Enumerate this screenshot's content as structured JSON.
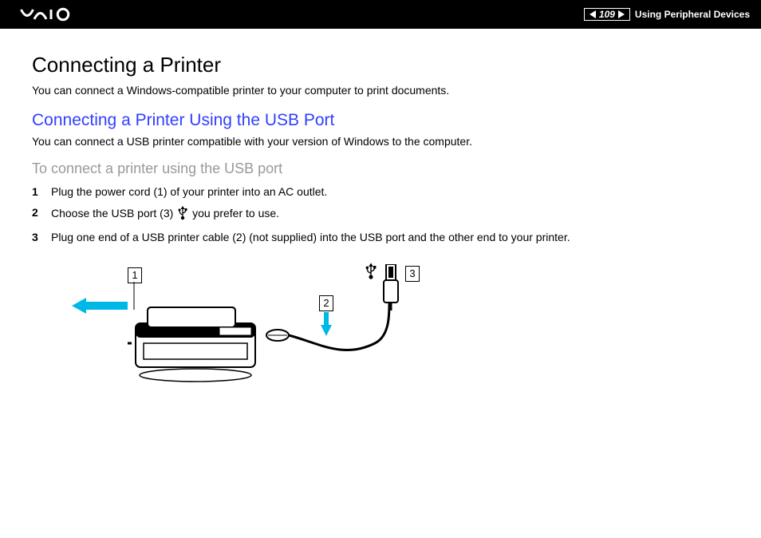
{
  "header": {
    "logo_alt": "VAIO",
    "page_number": "109",
    "breadcrumb": "Using Peripheral Devices"
  },
  "title": "Connecting a Printer",
  "intro": "You can connect a Windows-compatible printer to your computer to print documents.",
  "subtitle": "Connecting a Printer Using the USB Port",
  "sub_intro": "You can connect a USB printer compatible with your version of Windows to the computer.",
  "task_heading": "To connect a printer using the USB port",
  "steps": [
    {
      "num": "1",
      "text": "Plug the power cord (1) of your printer into an AC outlet."
    },
    {
      "num": "2",
      "text_before": "Choose the USB port (3) ",
      "text_after": " you prefer to use."
    },
    {
      "num": "3",
      "text": "Plug one end of a USB printer cable (2) (not supplied) into the USB port and the other end to your printer."
    }
  ],
  "diagram": {
    "callout1": "1",
    "callout2": "2",
    "callout3": "3"
  }
}
